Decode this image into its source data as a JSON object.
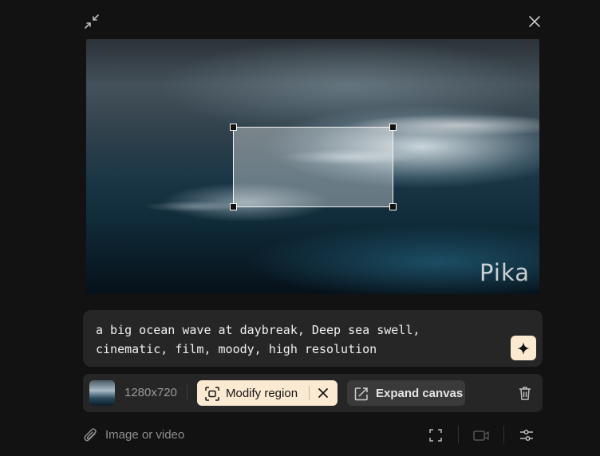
{
  "window": {
    "minimize_icon": "collapse-arrows-icon",
    "close_icon": "close-icon"
  },
  "preview": {
    "watermark": "Pika",
    "selection": "selection-region"
  },
  "prompt": {
    "line1": "a big ocean wave at daybreak, Deep sea swell,",
    "line2": "cinematic, film, moody, high resolution",
    "generate_icon": "sparkle-icon"
  },
  "toolbar": {
    "resolution": "1280x720",
    "modify_label": "Modify region",
    "expand_label": "Expand canvas",
    "delete_icon": "trash-icon"
  },
  "bottom": {
    "attach_label": "Image or video",
    "icons": [
      "fullscreen-icon",
      "video-camera-icon",
      "settings-sliders-icon"
    ]
  },
  "colors": {
    "background": "#121212",
    "panel": "#262626",
    "accent": "#fbe9d2"
  }
}
